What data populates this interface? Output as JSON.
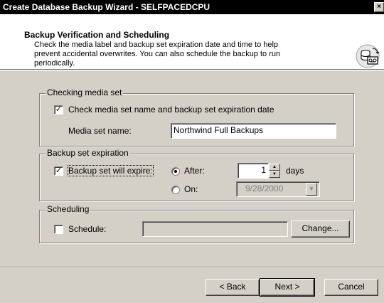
{
  "window": {
    "title": "Create Database Backup Wizard - SELFPACEDCPU",
    "close_glyph": "×"
  },
  "header": {
    "title": "Backup Verification and Scheduling",
    "description": "Check the media label and backup set expiration date and time to help prevent accidental overwrites. You can also schedule the backup to run periodically.",
    "icon": "database-backup-icon"
  },
  "checking_media": {
    "group_label": "Checking media set",
    "check_label": "Check media set name and backup set expiration date",
    "checked": true,
    "media_name_label": "Media set name:",
    "media_name_value": "Northwind Full Backups"
  },
  "expiration": {
    "group_label": "Backup set expiration",
    "check_label": "Backup set will expire:",
    "checked": true,
    "after_label": "After:",
    "after_selected": true,
    "after_value": "1",
    "days_label": "days",
    "on_label": "On:",
    "on_value": "9/28/2000"
  },
  "scheduling": {
    "group_label": "Scheduling",
    "check_label": "Schedule:",
    "checked": false,
    "schedule_value": "",
    "change_label": "Change..."
  },
  "buttons": {
    "back": "< Back",
    "next": "Next >",
    "cancel": "Cancel"
  },
  "glyphs": {
    "check": "✓",
    "spin_up": "▲",
    "spin_down": "▼",
    "combo_down": "▼"
  }
}
